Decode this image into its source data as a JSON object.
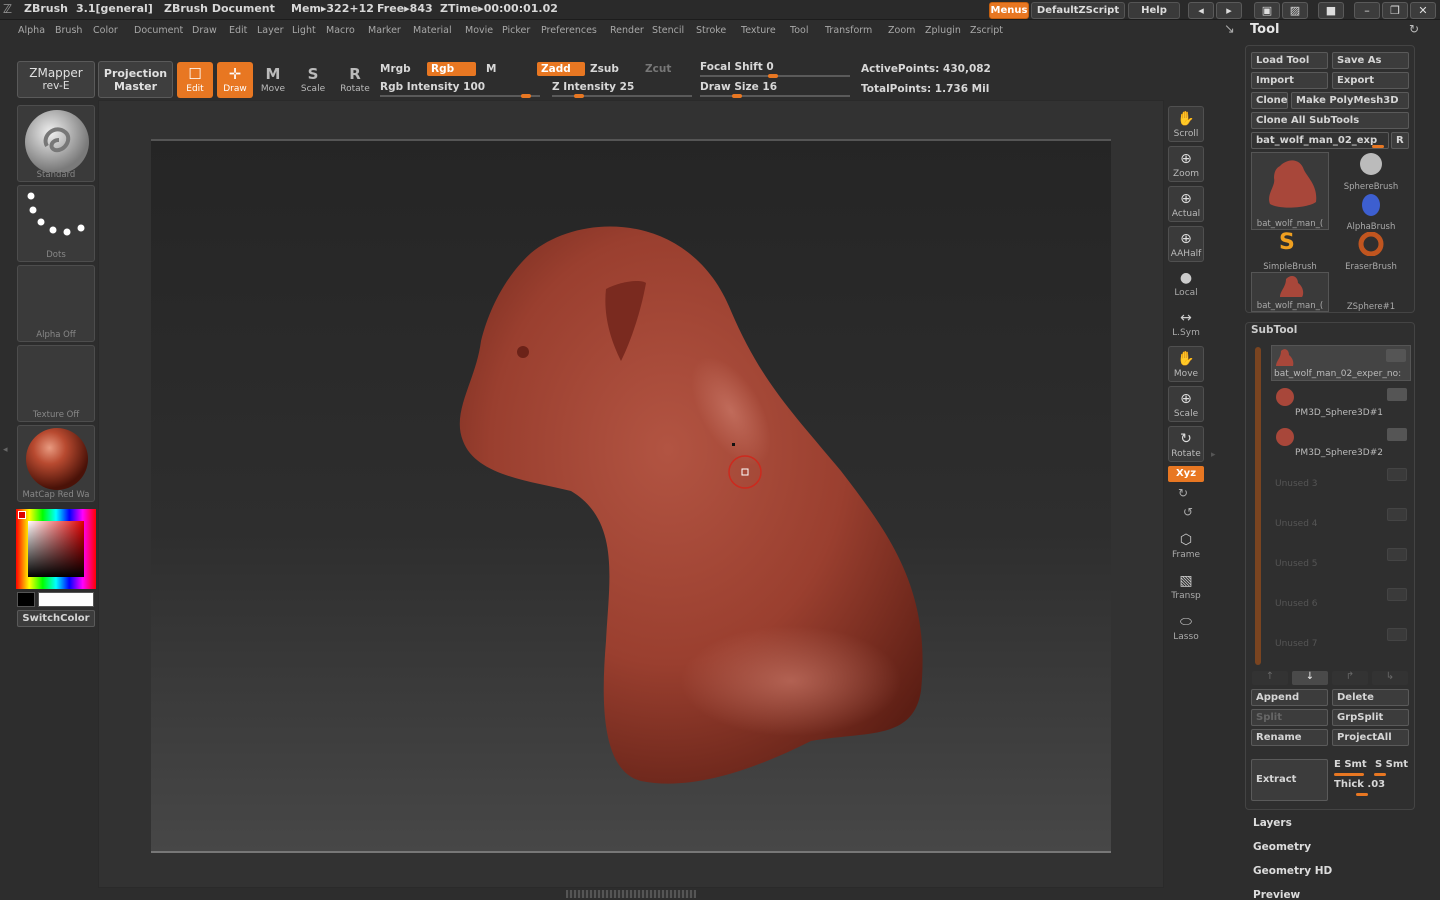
{
  "title_bar": {
    "app_name": "ZBrush",
    "version": "3.1[general]",
    "document": "ZBrush Document",
    "mem": "Mem▸322+12",
    "free": "Free▸843",
    "ztime": "ZTime▸00:00:01.02",
    "menus_label": "Menus",
    "script_label": "DefaultZScript",
    "help_label": "Help"
  },
  "menubar": [
    "Alpha",
    "Brush",
    "Color",
    "Document",
    "Draw",
    "Edit",
    "Layer",
    "Light",
    "Macro",
    "Marker",
    "Material",
    "Movie",
    "Picker",
    "Preferences",
    "Render",
    "Stencil",
    "Stroke",
    "Texture",
    "Tool",
    "Transform",
    "Zoom",
    "Zplugin",
    "Zscript"
  ],
  "toolbar": {
    "zmapper_line1": "ZMapper",
    "zmapper_line2": "rev-E",
    "projection_line1": "Projection",
    "projection_line2": "Master",
    "modes": [
      {
        "label": "Edit",
        "glyph": "☐",
        "active": true
      },
      {
        "label": "Draw",
        "glyph": "✛",
        "active": true
      },
      {
        "label": "Move",
        "glyph": "M",
        "active": false
      },
      {
        "label": "Scale",
        "glyph": "S",
        "active": false
      },
      {
        "label": "Rotate",
        "glyph": "R",
        "active": false
      }
    ],
    "mrgb": "Mrgb",
    "rgb": "Rgb",
    "m": "M",
    "rgb_intensity": "Rgb Intensity 100",
    "zadd": "Zadd",
    "zsub": "Zsub",
    "zcut": "Zcut",
    "z_intensity": "Z Intensity 25",
    "focal_shift": "Focal Shift 0",
    "draw_size": "Draw Size 16",
    "active_points": "ActivePoints: 430,082",
    "total_points": "TotalPoints: 1.736 Mil"
  },
  "left_tray": {
    "brush": "Standard",
    "stroke": "Dots",
    "alpha": "Alpha Off",
    "texture": "Texture Off",
    "material": "MatCap Red Wa",
    "switch_color": "SwitchColor"
  },
  "right_shelf": [
    "Scroll",
    "Zoom",
    "Actual",
    "AAHalf",
    "Local",
    "L.Sym",
    "Move",
    "Scale",
    "Rotate",
    "Frame",
    "Transp",
    "Lasso"
  ],
  "xyz_label": "Xyz",
  "tool_palette": {
    "title": "Tool",
    "load_tool": "Load Tool",
    "save_as": "Save As",
    "import": "Import",
    "export": "Export",
    "clone": "Clone",
    "make_polymesh": "Make PolyMesh3D",
    "clone_all": "Clone All SubTools",
    "current_tool": "bat_wolf_man_02_exp",
    "r_label": "R",
    "thumbnails": [
      "bat_wolf_man_(",
      "SphereBrush",
      "AlphaBrush",
      "SimpleBrush",
      "EraserBrush",
      "bat_wolf_man_(",
      "ZSphere#1"
    ]
  },
  "subtool": {
    "title": "SubTool",
    "items": [
      {
        "name": "bat_wolf_man_02_exper_no:",
        "used": true
      },
      {
        "name": "PM3D_Sphere3D#1",
        "used": true
      },
      {
        "name": "PM3D_Sphere3D#2",
        "used": true
      },
      {
        "name": "Unused 3",
        "used": false
      },
      {
        "name": "Unused 4",
        "used": false
      },
      {
        "name": "Unused 5",
        "used": false
      },
      {
        "name": "Unused 6",
        "used": false
      },
      {
        "name": "Unused 7",
        "used": false
      }
    ],
    "append": "Append",
    "delete": "Delete",
    "split": "Split",
    "grpsplit": "GrpSplit",
    "rename": "Rename",
    "projectall": "ProjectAll",
    "extract": "Extract",
    "e_smt": "E Smt",
    "s_smt": "S Smt",
    "thick": "Thick .03"
  },
  "sections": [
    "Layers",
    "Geometry",
    "Geometry HD",
    "Preview"
  ],
  "colors": {
    "accent": "#e87722",
    "model": "#a8473a"
  }
}
